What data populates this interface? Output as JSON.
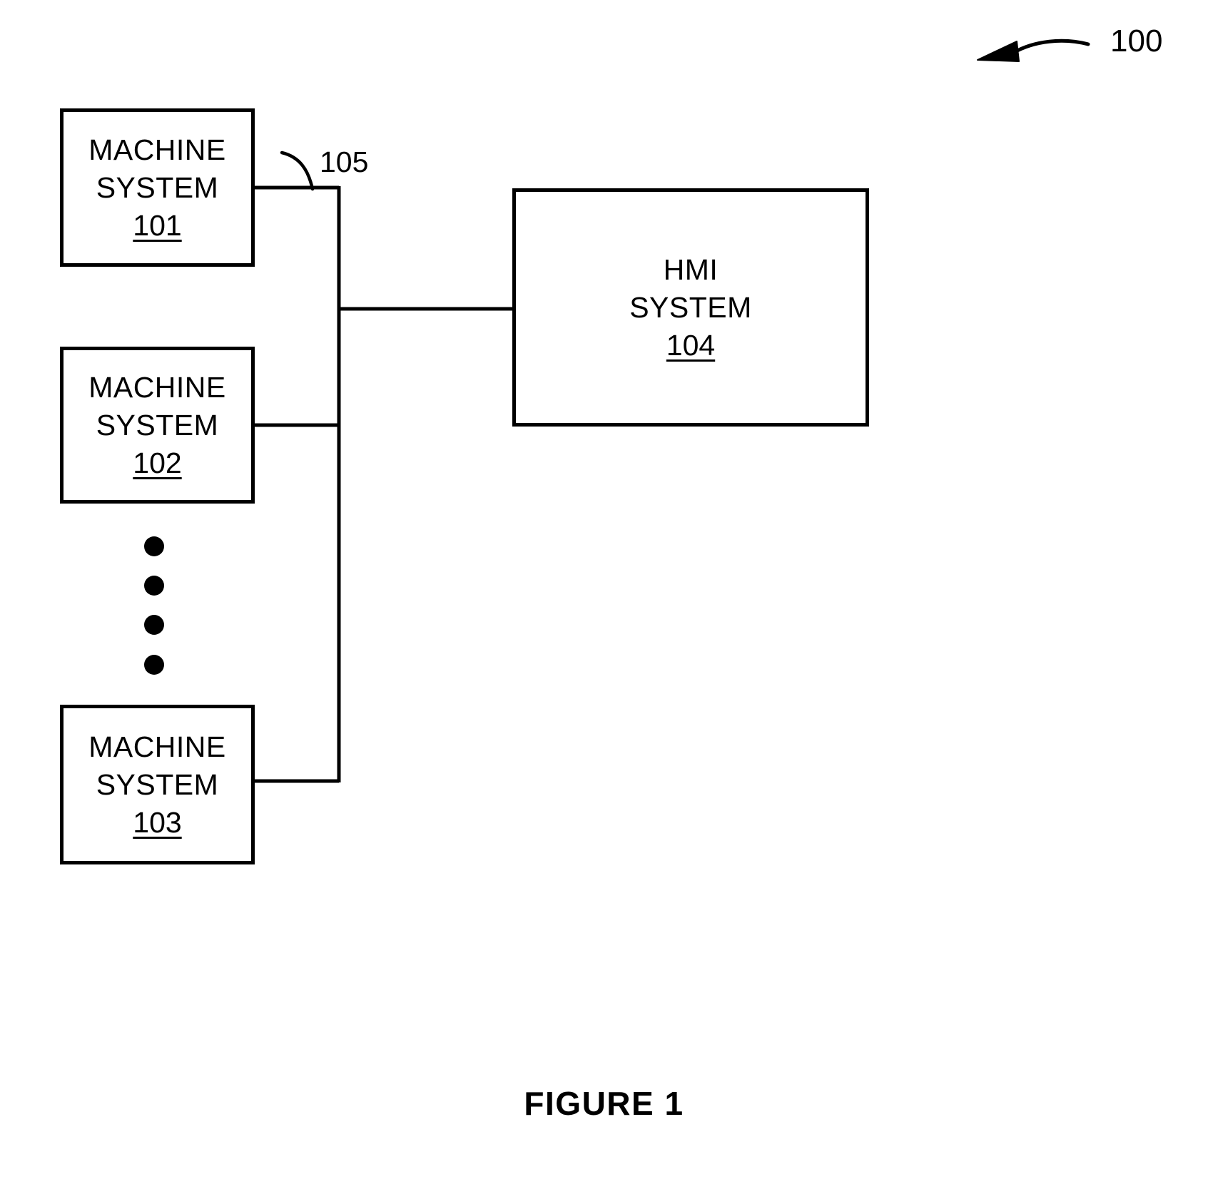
{
  "figure": {
    "caption": "FIGURE 1",
    "overall_ref": "100",
    "bus_ref": "105"
  },
  "nodes": [
    {
      "id": "machine-system-101",
      "line1": "MACHINE",
      "line2": "SYSTEM",
      "ref": "101"
    },
    {
      "id": "machine-system-102",
      "line1": "MACHINE",
      "line2": "SYSTEM",
      "ref": "102"
    },
    {
      "id": "machine-system-103",
      "line1": "MACHINE",
      "line2": "SYSTEM",
      "ref": "103"
    },
    {
      "id": "hmi-system-104",
      "line1": "HMI",
      "line2": "SYSTEM",
      "ref": "104"
    }
  ],
  "ellipsis": {
    "dot_count": 4,
    "meaning": "additional machine systems"
  },
  "colors": {
    "stroke": "#000000",
    "background": "#ffffff"
  }
}
